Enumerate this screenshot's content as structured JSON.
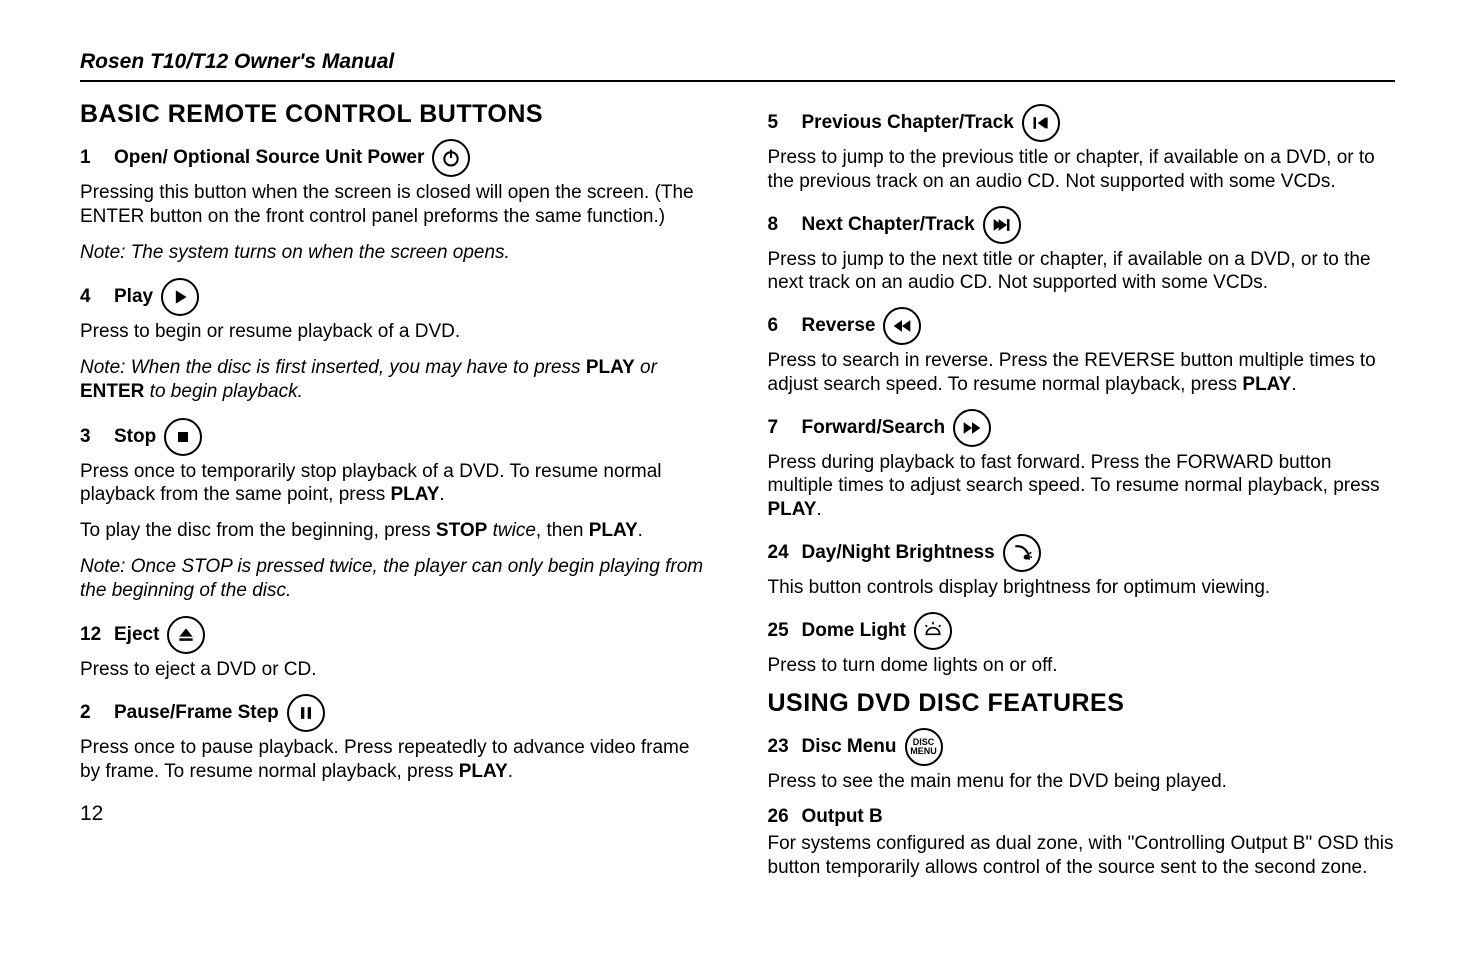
{
  "header": {
    "running_title": "Rosen T10/T12 Owner's Manual"
  },
  "footer": {
    "page_number": "12"
  },
  "left": {
    "section_title": "BASIC REMOTE CONTROL BUTTONS",
    "b1": {
      "num": "1",
      "label": "Open/ Optional Source Unit Power",
      "body": "Pressing this button when the screen is closed will open the screen. (The ENTER button on the front control panel preforms the same function.)",
      "note": "Note: The system turns on when the screen opens."
    },
    "b4": {
      "num": "4",
      "label": "Play",
      "body": "Press to begin or resume playback of a DVD.",
      "note_pre": "Note: When the disc is first inserted, you may have to press ",
      "note_bold1": "PLAY",
      "note_mid": " or ",
      "note_bold2": "ENTER",
      "note_post": " to begin playback."
    },
    "b3": {
      "num": "3",
      "label": "Stop",
      "body_pre": "Press once to temporarily stop playback of a DVD. To resume normal playback from the same point, press ",
      "body_bold": "PLAY",
      "body_post": ".",
      "body2_a": "To play the disc from the beginning, press ",
      "body2_b": "STOP",
      "body2_c": " twice",
      "body2_d": ", then ",
      "body2_e": "PLAY",
      "body2_f": ".",
      "note": "Note: Once STOP is pressed twice, the player can only begin playing from the beginning of the disc."
    },
    "b12": {
      "num": "12",
      "label": "Eject",
      "body": "Press to eject a DVD or CD."
    },
    "b2": {
      "num": "2",
      "label": "Pause/Frame Step",
      "body_pre": "Press once to pause playback. Press repeatedly to advance video frame by frame. To resume normal playback, press ",
      "body_bold": "PLAY",
      "body_post": "."
    }
  },
  "right": {
    "b5": {
      "num": "5",
      "label": "Previous Chapter/Track",
      "body": "Press to jump to the previous title or chapter, if available on a DVD, or to the previous track on an audio CD. Not supported with some VCDs."
    },
    "b8": {
      "num": "8",
      "label": "Next Chapter/Track",
      "body": "Press to jump to the next title or chapter, if available on a DVD, or to the next track on an audio CD. Not supported with some VCDs."
    },
    "b6": {
      "num": "6",
      "label": "Reverse",
      "body_pre": "Press to search in reverse. Press the REVERSE button multiple times to adjust search speed. To resume normal playback, press ",
      "body_bold": "PLAY",
      "body_post": "."
    },
    "b7": {
      "num": "7",
      "label": "Forward/Search",
      "body_pre": "Press during playback to fast forward. Press the FORWARD button multiple times to adjust search speed. To resume normal playback, press ",
      "body_bold": "PLAY",
      "body_post": "."
    },
    "b24": {
      "num": "24",
      "label": "Day/Night Brightness",
      "body": "This button controls display brightness for optimum viewing."
    },
    "b25": {
      "num": "25",
      "label": "Dome Light",
      "body": "Press to turn dome lights on or off."
    },
    "section2_title": "USING DVD DISC FEATURES",
    "b23": {
      "num": "23",
      "label": "Disc Menu",
      "icon_text": "DISC\nMENU",
      "body": "Press to see the main menu for the DVD being played."
    },
    "b26": {
      "num": "26",
      "label": "Output B",
      "body": "For systems configured as dual zone, with \"Controlling Output B\" OSD this button temporarily allows control of the source sent to the second zone."
    }
  }
}
